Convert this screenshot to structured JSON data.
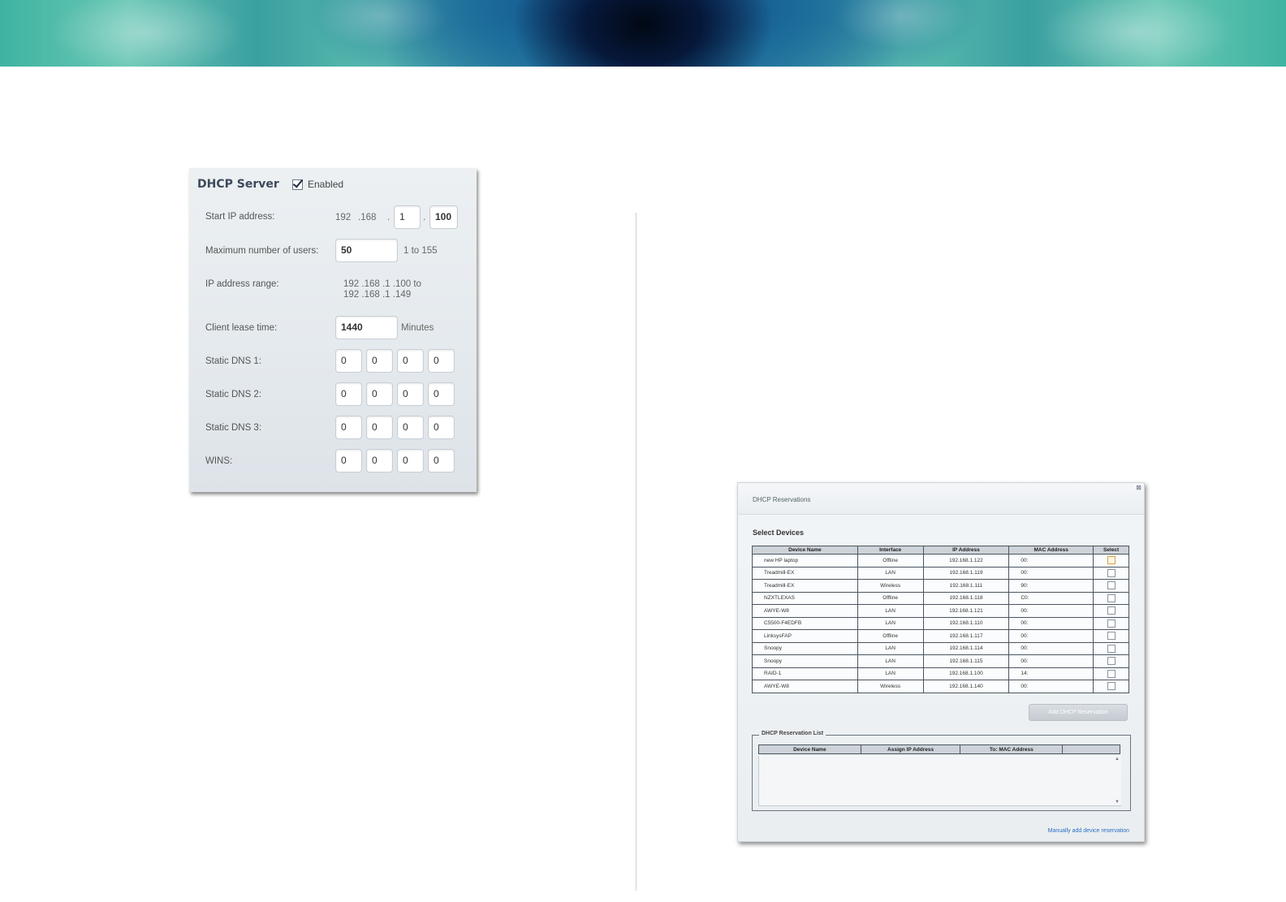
{
  "dhcp_server": {
    "title": "DHCP Server",
    "enabled_label": "Enabled",
    "enabled_checked": true,
    "start_ip_label": "Start IP address:",
    "start_ip_octet1": "192",
    "start_ip_sep1": ".168",
    "start_ip_sep2": ".",
    "start_ip_octet3": "1",
    "start_ip_sep3": ".",
    "start_ip_octet4": "100",
    "max_users_label": "Maximum number of users:",
    "max_users_value": "50",
    "max_users_hint": "1 to 155",
    "ip_range_label": "IP address range:",
    "ip_range_line1": "192 .168 .1 .100  to",
    "ip_range_line2": "192 .168 .1 .149",
    "lease_label": "Client lease time:",
    "lease_value": "1440",
    "lease_unit": "Minutes",
    "dns1_label": "Static DNS 1:",
    "dns1": [
      "0",
      "0",
      "0",
      "0"
    ],
    "dns2_label": "Static DNS 2:",
    "dns2": [
      "0",
      "0",
      "0",
      "0"
    ],
    "dns3_label": "Static DNS 3:",
    "dns3": [
      "0",
      "0",
      "0",
      "0"
    ],
    "wins_label": "WINS:",
    "wins": [
      "0",
      "0",
      "0",
      "0"
    ]
  },
  "reservations": {
    "window_title": "DHCP Reservations",
    "close_icon": "close-icon",
    "select_devices_heading": "Select Devices",
    "columns": [
      "Device Name",
      "Interface",
      "IP Address",
      "MAC Address",
      "Select"
    ],
    "rows": [
      {
        "name": "new HP laptop",
        "interface": "Offline",
        "ip": "192.168.1.122",
        "mac": "00:",
        "checked": false
      },
      {
        "name": "Treadmill-EX",
        "interface": "LAN",
        "ip": "192.168.1.119",
        "mac": "00:",
        "checked": false
      },
      {
        "name": "Treadmill-EX",
        "interface": "Wireless",
        "ip": "192.168.1.111",
        "mac": "90:",
        "checked": false
      },
      {
        "name": "NZXTLEXAS",
        "interface": "Offline",
        "ip": "192.168.1.118",
        "mac": "C0:",
        "checked": false
      },
      {
        "name": "AWYE-W8",
        "interface": "LAN",
        "ip": "192.168.1.121",
        "mac": "00:",
        "checked": false
      },
      {
        "name": "C5500-F4EDFB",
        "interface": "LAN",
        "ip": "192.168.1.110",
        "mac": "00:",
        "checked": false
      },
      {
        "name": "LinksysFAP",
        "interface": "Offline",
        "ip": "192.168.1.117",
        "mac": "00:",
        "checked": false
      },
      {
        "name": "Snoopy",
        "interface": "LAN",
        "ip": "192.168.1.114",
        "mac": "00:",
        "checked": false
      },
      {
        "name": "Snoopy",
        "interface": "LAN",
        "ip": "192.168.1.115",
        "mac": "00:",
        "checked": false
      },
      {
        "name": "RAID-1",
        "interface": "LAN",
        "ip": "192.168.1.100",
        "mac": "14:",
        "checked": false
      },
      {
        "name": "AWYE-W8",
        "interface": "Wireless",
        "ip": "192.168.1.140",
        "mac": "00:",
        "checked": false
      }
    ],
    "add_button": "Add DHCP Reservation",
    "list_legend": "DHCP Reservation List",
    "list_columns": [
      "Device Name",
      "Assign IP Address",
      "To: MAC Address",
      ""
    ],
    "manual_link": "Manually add device reservation"
  }
}
